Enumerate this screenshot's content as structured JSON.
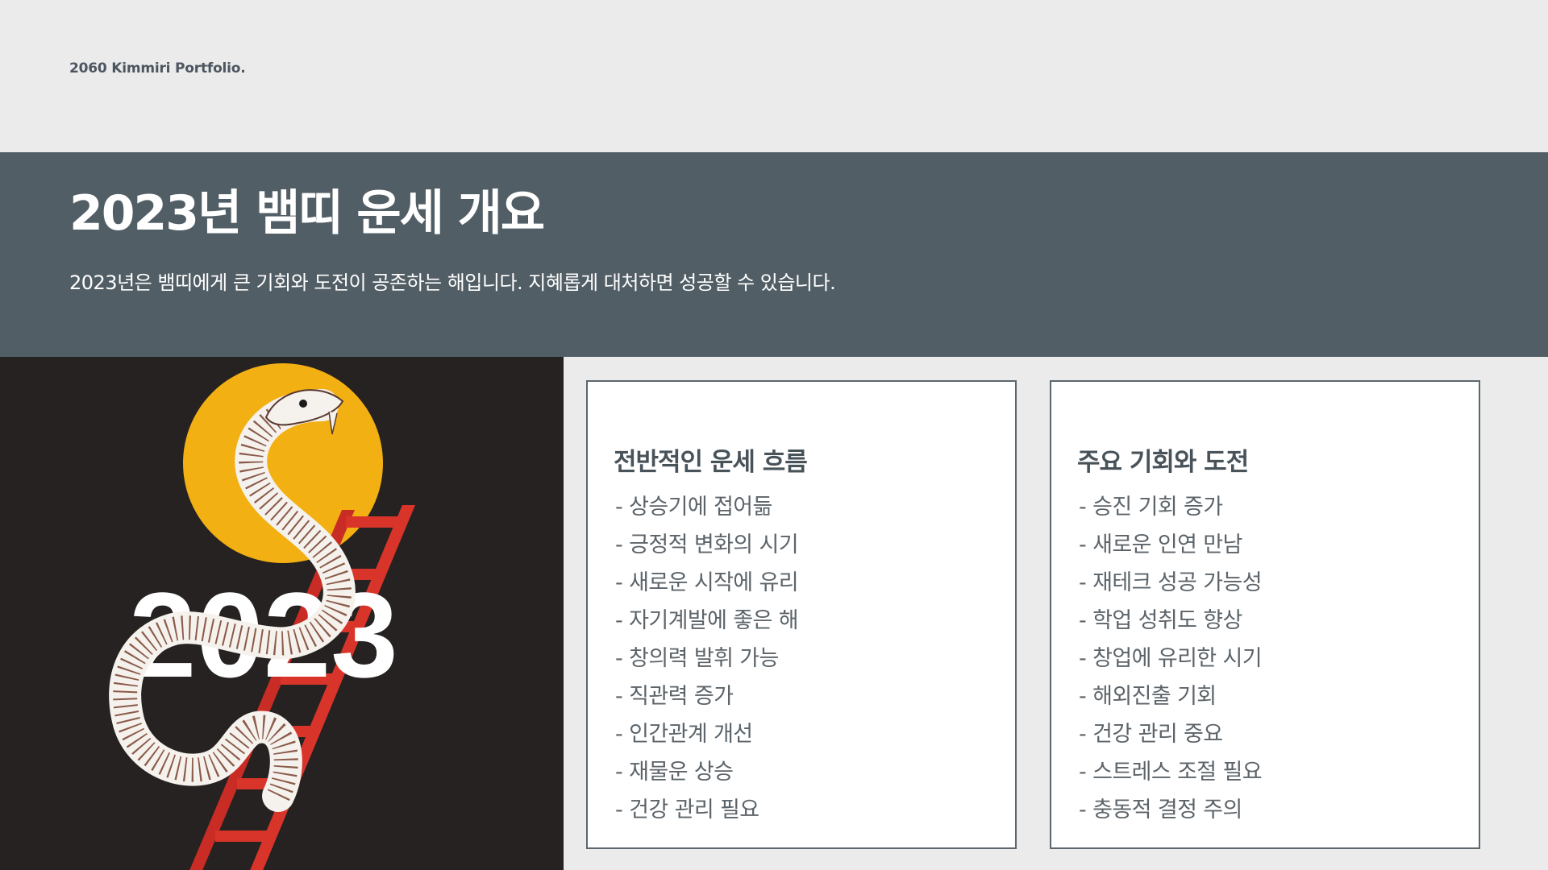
{
  "brand": "2060 Kimmiri Portfolio.",
  "hero": {
    "title": "2023년 뱀띠 운세 개요",
    "subtitle": "2023년은 뱀띠에게 큰 기회와 도전이 공존하는 해입니다. 지혜롭게 대처하면 성공할 수 있습니다."
  },
  "illustration": {
    "year_text": "2023",
    "colors": {
      "background": "#262221",
      "sun": "#f3b012",
      "ladder": "#d9342a",
      "snake": "#ffffff"
    }
  },
  "cards": [
    {
      "title": "전반적인 운세 흐름",
      "items": [
        "- 상승기에 접어듦",
        "- 긍정적 변화의 시기",
        "- 새로운 시작에 유리",
        "- 자기계발에 좋은 해",
        "- 창의력 발휘 가능",
        "- 직관력 증가",
        "- 인간관계 개선",
        "- 재물운 상승",
        "- 건강 관리 필요"
      ]
    },
    {
      "title": "주요 기회와 도전",
      "items": [
        "- 승진 기회 증가",
        "- 새로운 인연 만남",
        "- 재테크 성공 가능성",
        "- 학업 성취도 향상",
        "- 창업에 유리한 시기",
        "- 해외진출 기회",
        "- 건강 관리 중요",
        "- 스트레스 조절 필요",
        "- 충동적 결정 주의"
      ]
    }
  ],
  "colors": {
    "page_bg": "#ebebeb",
    "hero_bg": "#525e65",
    "card_border": "#5c666d",
    "heading_text": "#485259",
    "body_text": "#5c646a"
  }
}
